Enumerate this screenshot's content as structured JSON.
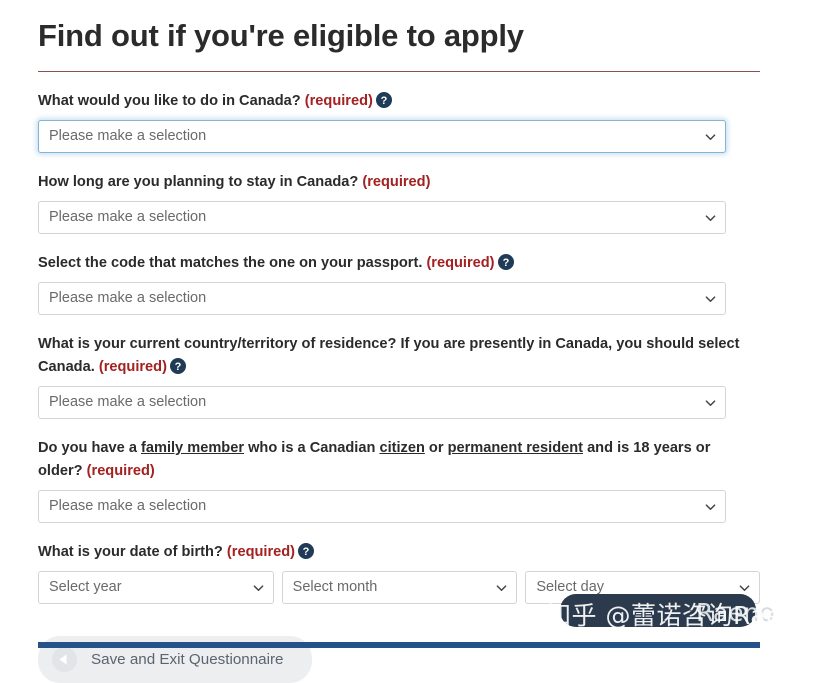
{
  "page": {
    "title": "Find out if you're eligible to apply"
  },
  "questions": [
    {
      "id": "activity-in-canada",
      "label_parts": [
        {
          "type": "text",
          "text": "What would you like to do in Canada? "
        },
        {
          "type": "required",
          "text": "(required)"
        }
      ],
      "has_help_icon": true,
      "help_icon": "help-circle-icon",
      "select": {
        "name": "activity-select",
        "value": "Please make a selection",
        "focused": true,
        "options": [
          "Please make a selection"
        ]
      }
    },
    {
      "id": "length-of-stay",
      "label_parts": [
        {
          "type": "text",
          "text": "How long are you planning to stay in Canada? "
        },
        {
          "type": "required",
          "text": "(required)"
        }
      ],
      "has_help_icon": false,
      "select": {
        "name": "length-of-stay-select",
        "value": "Please make a selection",
        "focused": false,
        "options": [
          "Please make a selection"
        ]
      }
    },
    {
      "id": "passport-code",
      "label_parts": [
        {
          "type": "text",
          "text": "Select the code that matches the one on your passport. "
        },
        {
          "type": "required",
          "text": "(required)"
        }
      ],
      "has_help_icon": true,
      "help_icon": "help-circle-icon",
      "select": {
        "name": "passport-code-select",
        "value": "Please make a selection",
        "focused": false,
        "options": [
          "Please make a selection"
        ]
      }
    },
    {
      "id": "country-of-residence",
      "label_parts": [
        {
          "type": "text",
          "text": "What is your current country/territory of residence? If you are presently in Canada, you should select Canada. "
        },
        {
          "type": "required",
          "text": "(required)"
        }
      ],
      "has_help_icon": true,
      "help_icon": "help-circle-icon",
      "select": {
        "name": "country-of-residence-select",
        "value": "Please make a selection",
        "focused": false,
        "options": [
          "Please make a selection"
        ]
      }
    },
    {
      "id": "family-member-in-canada",
      "label_parts": [
        {
          "type": "text",
          "text": "Do you have a "
        },
        {
          "type": "link",
          "text": "family member"
        },
        {
          "type": "text",
          "text": " who is a Canadian "
        },
        {
          "type": "link",
          "text": "citizen"
        },
        {
          "type": "text",
          "text": " or "
        },
        {
          "type": "link",
          "text": "permanent resident"
        },
        {
          "type": "text",
          "text": " and is 18 years or older? "
        },
        {
          "type": "required",
          "text": "(required)"
        }
      ],
      "has_help_icon": false,
      "select": {
        "name": "family-member-select",
        "value": "Please make a selection",
        "focused": false,
        "options": [
          "Please make a selection"
        ]
      }
    }
  ],
  "date_of_birth": {
    "label_text": "What is your date of birth? ",
    "required_text": "(required)",
    "has_help_icon": true,
    "help_icon": "help-circle-icon",
    "year": {
      "value": "Select year",
      "options": [
        "Select year"
      ]
    },
    "month": {
      "value": "Select month",
      "options": [
        "Select month"
      ]
    },
    "day": {
      "value": "Select day",
      "options": [
        "Select day"
      ]
    }
  },
  "actions": {
    "save_exit_label": "Save and Exit Questionnaire",
    "save_exit_icon": "arrow-left-circle-icon"
  },
  "watermark": {
    "text": "知乎 @蕾诺咨询Raeno",
    "ghost_text": "Raeno"
  },
  "colors": {
    "required": "#a32121",
    "title_rule": "#8a5050",
    "focus_border": "#86b4d4",
    "footer_bar": "#26528a",
    "help_icon": "#1f3b57",
    "button_bg": "#eceef0"
  }
}
